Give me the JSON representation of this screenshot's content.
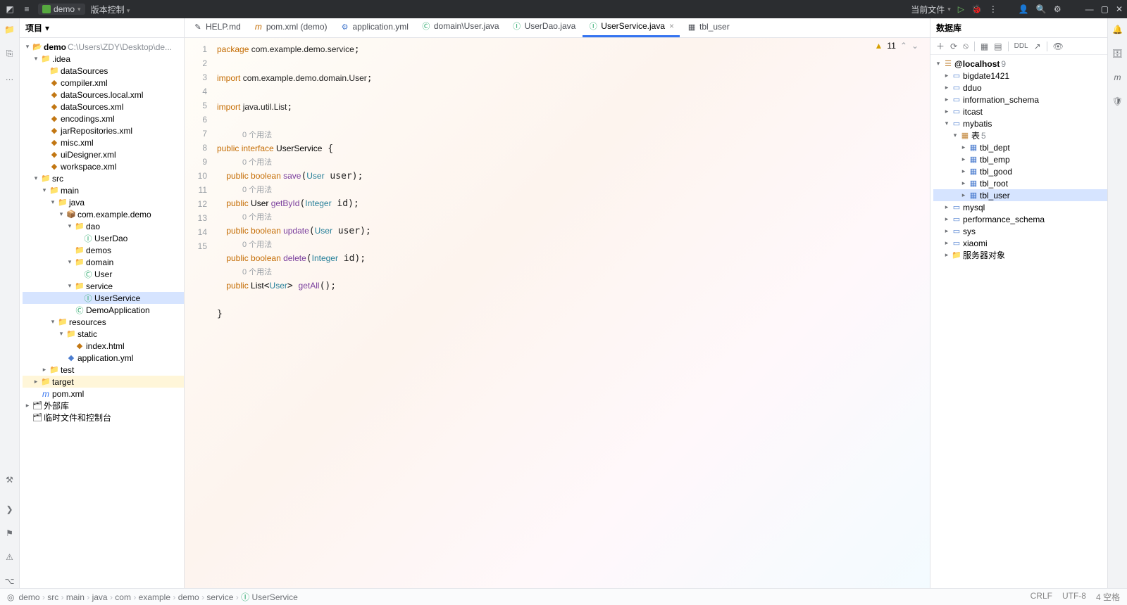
{
  "topbar": {
    "project": "demo",
    "vcs": "版本控制",
    "current_file": "当前文件",
    "icons": [
      "run",
      "debug",
      "more",
      "user",
      "search",
      "settings",
      "minimize",
      "maximize",
      "close"
    ]
  },
  "project_panel": {
    "title": "项目",
    "root": "demo",
    "root_path": "C:\\Users\\ZDY\\Desktop\\de...",
    "idea": ".idea",
    "idea_children": [
      "dataSources",
      "compiler.xml",
      "dataSources.local.xml",
      "dataSources.xml",
      "encodings.xml",
      "jarRepositories.xml",
      "misc.xml",
      "uiDesigner.xml",
      "workspace.xml"
    ],
    "src": "src",
    "main": "main",
    "java": "java",
    "pkg": "com.example.demo",
    "dao": "dao",
    "dao_children": [
      "UserDao"
    ],
    "demos": "demos",
    "domain": "domain",
    "domain_children": [
      "User"
    ],
    "service": "service",
    "service_children": [
      "UserService"
    ],
    "demo_app": "DemoApplication",
    "resources": "resources",
    "static": "static",
    "static_children": [
      "index.html"
    ],
    "app_yml": "application.yml",
    "test": "test",
    "target": "target",
    "pom": "pom.xml",
    "ext_lib": "外部库",
    "scratch": "临时文件和控制台"
  },
  "tabs": [
    {
      "icon": "md",
      "label": "HELP.md",
      "active": false
    },
    {
      "icon": "m",
      "label": "pom.xml (demo)",
      "active": false
    },
    {
      "icon": "cfg",
      "label": "application.yml",
      "active": false
    },
    {
      "icon": "cls",
      "label": "domain\\User.java",
      "active": false
    },
    {
      "icon": "int",
      "label": "UserDao.java",
      "active": false
    },
    {
      "icon": "int",
      "label": "UserService.java",
      "active": true
    },
    {
      "icon": "tbl",
      "label": "tbl_user",
      "active": false
    }
  ],
  "inspection": {
    "warn_count": "11"
  },
  "code": {
    "usage": "0 个用法",
    "lines": [
      "1",
      "2",
      "3",
      "4",
      "5",
      "6",
      "7",
      "8",
      "9",
      "10",
      "11",
      "12",
      "13",
      "14",
      "15"
    ],
    "l1a": "package ",
    "l1b": "com.example.demo.service",
    "l1c": ";",
    "l3a": "import ",
    "l3b": "com.example.demo.domain.User",
    "l3c": ";",
    "l5a": "import ",
    "l5b": "java.util.List",
    "l5c": ";",
    "l7a": "public interface ",
    "l7b": "UserService",
    " l7c": " {",
    "l8a": "    public ",
    "l8b": "boolean ",
    "l8c": "save",
    "l8d": "(",
    "l8e": "User",
    "l8f": " user);",
    "l9a": "    public ",
    "l9b": "User ",
    "l9c": "getById",
    "l9d": "(",
    "l9e": "Integer",
    "l9f": " id);",
    "l10a": "    public ",
    "l10b": "boolean ",
    "l10c": "update",
    "l10d": "(",
    "l10e": "User",
    "l10f": " user);",
    "l11a": "    public ",
    "l11b": "boolean ",
    "l11c": "delete",
    "l11d": "(",
    "l11e": "Integer",
    "l11f": " id);",
    "l12a": "    public ",
    "l12b": "List",
    "l12c": "<",
    "l12d": "User",
    "l12e": "> ",
    "l12f": "getAll",
    "l12g": "();",
    "l14": "}"
  },
  "db_panel": {
    "title": "数据库",
    "toolbar_icons": [
      "add",
      "refresh",
      "stop",
      "filter",
      "ddl",
      "dml",
      "eye"
    ],
    "host": "@localhost",
    "host_count": "9",
    "schemas": [
      "bigdate1421",
      "dduo",
      "information_schema",
      "itcast"
    ],
    "mybatis": "mybatis",
    "tables_label": "表",
    "tables_count": "5",
    "tables": [
      "tbl_dept",
      "tbl_emp",
      "tbl_good",
      "tbl_root",
      "tbl_user"
    ],
    "schemas2": [
      "mysql",
      "performance_schema",
      "sys",
      "xiaomi"
    ],
    "server_obj": "服务器对象"
  },
  "breadcrumb": [
    "demo",
    "src",
    "main",
    "java",
    "com",
    "example",
    "demo",
    "service",
    "UserService"
  ],
  "status": {
    "crlf": "CRLF",
    "enc": "UTF-8",
    "ro": "⍰",
    "sp": "4 空格"
  }
}
